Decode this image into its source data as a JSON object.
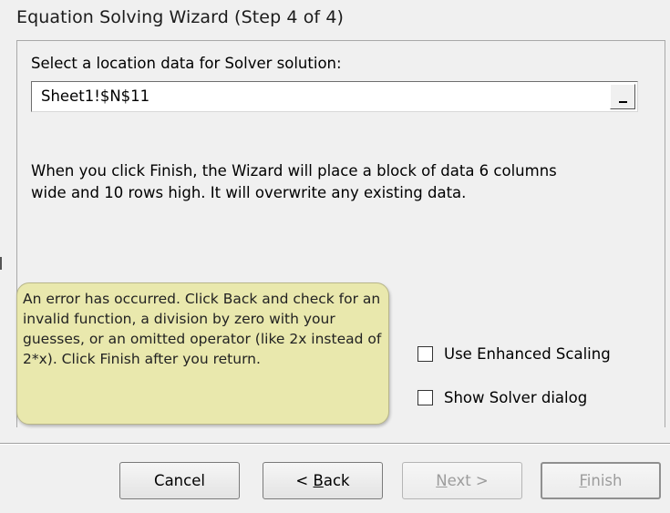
{
  "window": {
    "title": "Equation Solving Wizard (Step 4 of 4)"
  },
  "location": {
    "prompt": "Select a location data for Solver solution:",
    "value": "Sheet1!$N$11"
  },
  "info_text": "When you click Finish, the Wizard will place a block of data 6 columns wide and 10 rows high. It will overwrite any existing data.",
  "error_text": "An error has occurred. Click Back and check for an invalid function, a division by zero with your guesses, or an omitted operator (like 2x instead of 2*x). Click Finish after you return.",
  "options": {
    "enhanced_scaling": {
      "label": "Use Enhanced Scaling",
      "checked": false
    },
    "show_solver": {
      "label": "Show Solver dialog",
      "checked": false
    }
  },
  "buttons": {
    "cancel": {
      "label": "Cancel",
      "enabled": true
    },
    "back": {
      "pre": "< ",
      "mnemonic": "B",
      "post": "ack",
      "enabled": true
    },
    "next": {
      "pre": "",
      "mnemonic": "N",
      "post": "ext >",
      "enabled": false
    },
    "finish": {
      "pre": "",
      "mnemonic": "F",
      "post": "inish",
      "enabled": false
    }
  },
  "colors": {
    "error_background": "#e9e8ad",
    "dialog_background": "#f0f0f0"
  }
}
